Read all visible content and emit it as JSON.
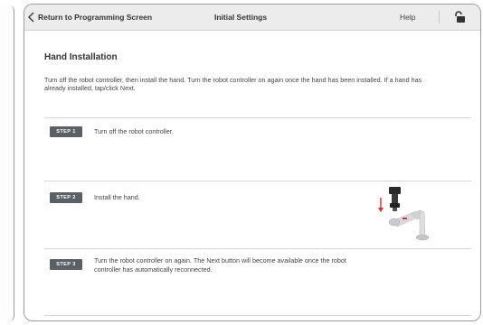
{
  "header": {
    "back_label": "Return to Programming Screen",
    "title": "Initial Settings",
    "help_label": "Help",
    "back_icon": "chevron-left-icon",
    "lock_icon": "unlock-icon"
  },
  "main": {
    "title": "Hand Installation",
    "intro": "Turn off the robot controller, then install the hand. Turn the robot controller on again once the hand has been installed. If a hand has already installed, tap/click Next.",
    "steps": [
      {
        "badge": "STEP 1",
        "text": "Turn off the robot controller."
      },
      {
        "badge": "STEP 2",
        "text": "Install the hand."
      },
      {
        "badge": "STEP 3",
        "text": "Turn the robot controller on again. The Next button will become available once the robot controller has automatically reconnected."
      }
    ]
  },
  "colors": {
    "header_bg": "#ececec",
    "badge_bg": "#5b6066",
    "arrow_red": "#d9302c"
  }
}
